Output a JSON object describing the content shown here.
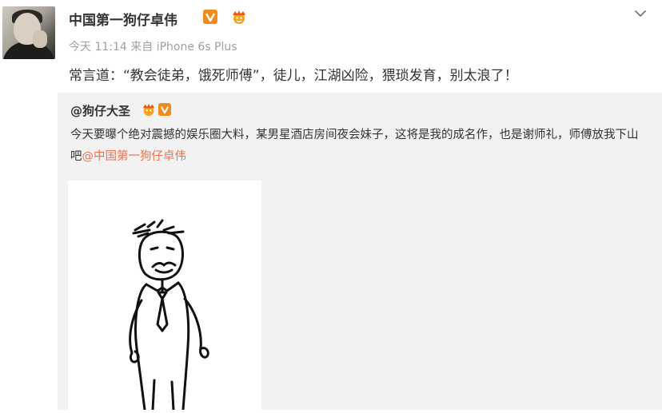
{
  "post": {
    "username": "中国第一狗仔卓伟",
    "time": "今天 11:14",
    "source_prefix": "来自",
    "source": "iPhone 6s Plus",
    "text": "常言道：“教会徒弟，饿死师傅”，徒儿，江湖凶险，猥琐发育，别太浪了！"
  },
  "repost": {
    "author": "@狗仔大圣",
    "text_part1": "今天要曝个绝对震撼的娱乐圈大料，某男星酒店房间夜会妹子，这将是我的成名作，也是谢师礼，师傅放我下山吧",
    "mention": "@中国第一狗仔卓伟"
  },
  "icons": {
    "verified": "verified-v-icon",
    "member": "crown-member-icon",
    "menu": "chevron-down-icon"
  },
  "colors": {
    "verified": "#f38a1c",
    "mention": "#eb7350",
    "repost_bg": "#f2f2f2",
    "meta": "#a0a0a0"
  }
}
